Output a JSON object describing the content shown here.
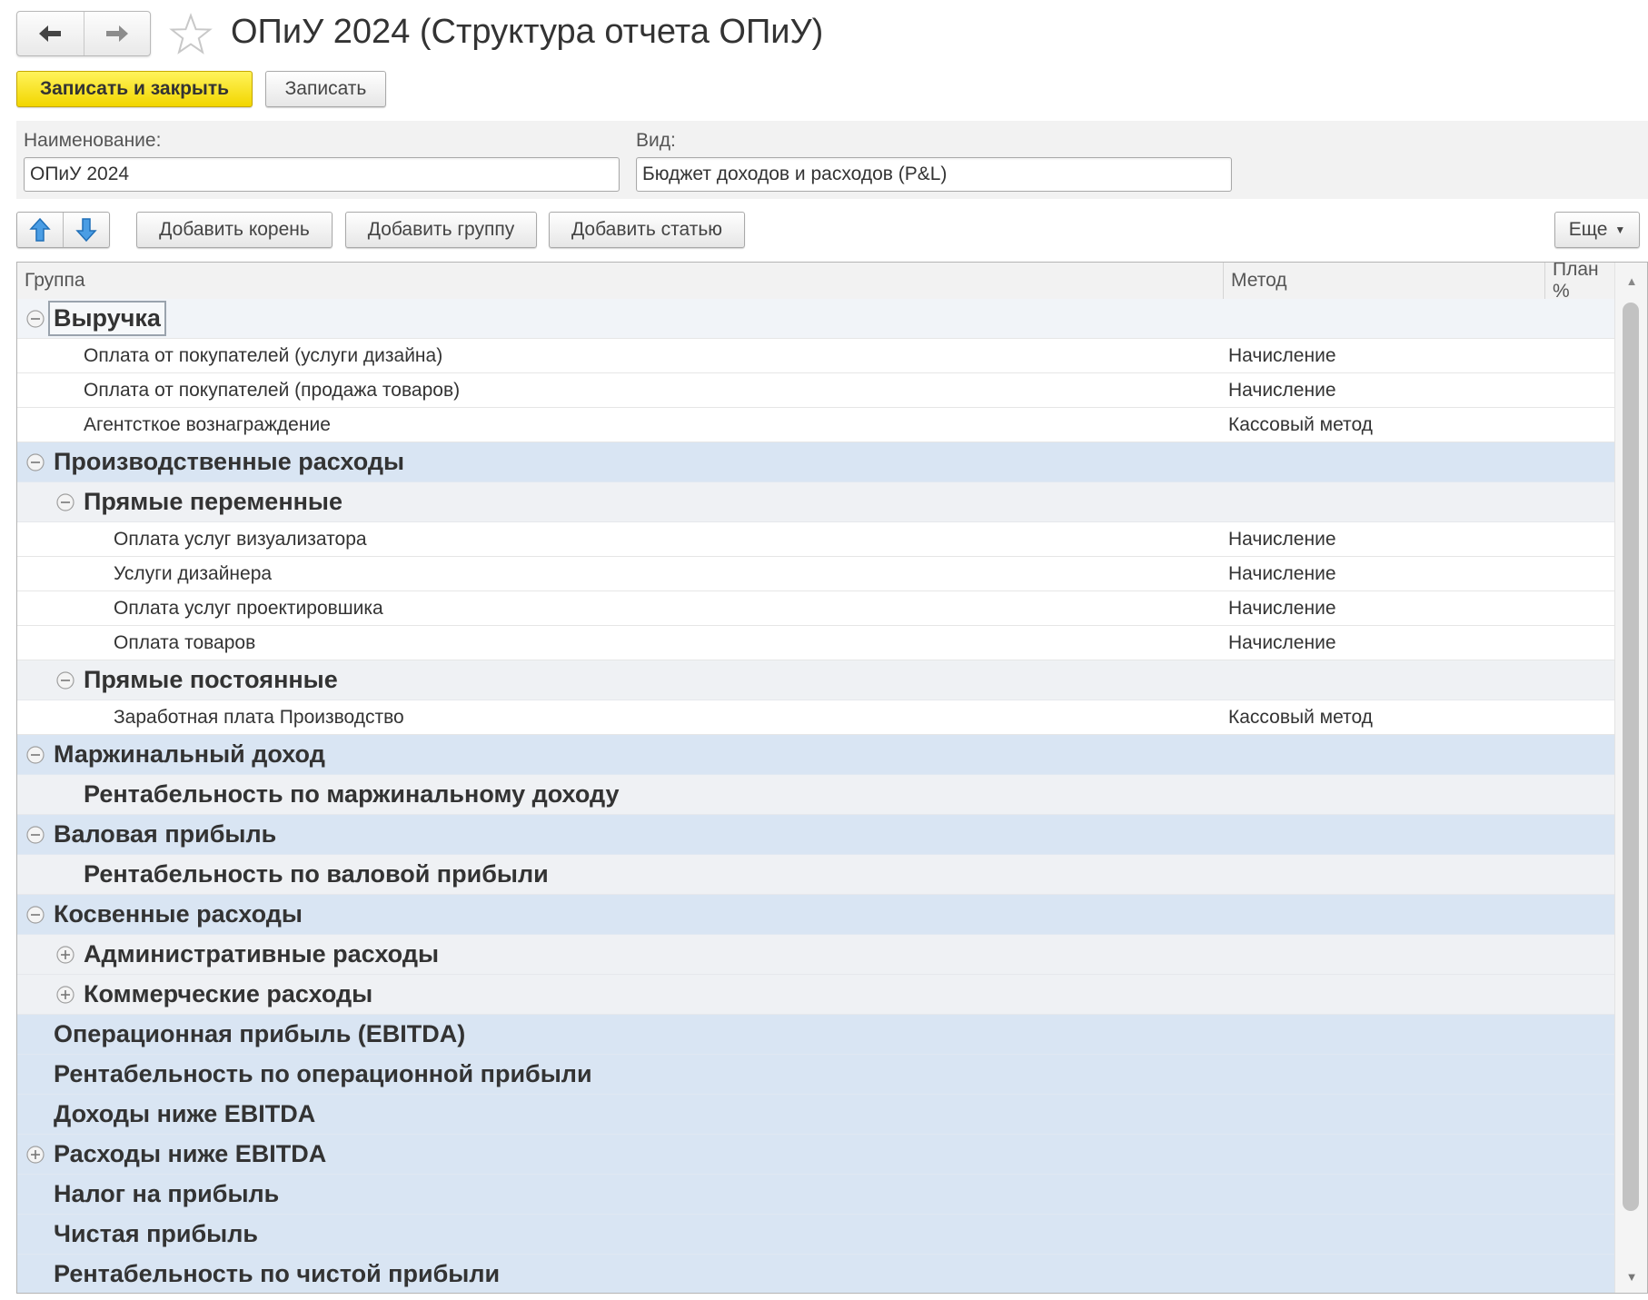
{
  "window": {
    "title": "ОПиУ 2024 (Структура отчета ОПиУ)",
    "back_icon": "arrow-left-icon",
    "forward_icon": "arrow-right-icon",
    "favorite_icon": "star-icon"
  },
  "command_bar": {
    "save_close_label": "Записать и закрыть",
    "save_label": "Записать"
  },
  "fields": {
    "name_label": "Наименование:",
    "name_value": "ОПиУ 2024",
    "kind_label": "Вид:",
    "kind_value": "Бюджет доходов и расходов (P&L)"
  },
  "toolbar": {
    "move_up_icon": "arrow-up-icon",
    "move_down_icon": "arrow-down-icon",
    "add_root_label": "Добавить корень",
    "add_group_label": "Добавить группу",
    "add_item_label": "Добавить статью",
    "more_label": "Еще"
  },
  "table": {
    "columns": [
      "Группа",
      "Метод",
      "План %"
    ],
    "rows": [
      {
        "name": "Выручка",
        "method": ""
      },
      {
        "name": "Оплата от покупателей (услуги дизайна)",
        "method": "Начисление"
      },
      {
        "name": "Оплата от покупателей (продажа товаров)",
        "method": "Начисление"
      },
      {
        "name": "Агентсткое вознаграждение",
        "method": "Кассовый метод"
      },
      {
        "name": "Производственные расходы",
        "method": ""
      },
      {
        "name": "Прямые переменные",
        "method": ""
      },
      {
        "name": "Оплата услуг визуализатора",
        "method": "Начисление"
      },
      {
        "name": "Услуги дизайнера",
        "method": "Начисление"
      },
      {
        "name": "Оплата услуг проектировшика",
        "method": "Начисление"
      },
      {
        "name": "Оплата товаров",
        "method": "Начисление"
      },
      {
        "name": "Прямые постоянные",
        "method": ""
      },
      {
        "name": "Заработная плата Производство",
        "method": "Кассовый метод"
      },
      {
        "name": "Маржинальный доход",
        "method": ""
      },
      {
        "name": "Рентабельность по маржинальному доходу",
        "method": ""
      },
      {
        "name": "Валовая прибыль",
        "method": ""
      },
      {
        "name": "Рентабельность по валовой прибыли",
        "method": ""
      },
      {
        "name": "Косвенные расходы",
        "method": ""
      },
      {
        "name": "Административные расходы",
        "method": ""
      },
      {
        "name": "Коммерческие расходы",
        "method": ""
      },
      {
        "name": "Операционная прибыль (EBITDA)",
        "method": ""
      },
      {
        "name": "Рентабельность по операционной прибыли",
        "method": ""
      },
      {
        "name": "Доходы ниже EBITDA",
        "method": ""
      },
      {
        "name": "Расходы ниже EBITDA",
        "method": ""
      },
      {
        "name": "Налог на прибыль",
        "method": ""
      },
      {
        "name": "Чистая прибыль",
        "method": ""
      },
      {
        "name": "Рентабельность по чистой прибыли",
        "method": ""
      }
    ]
  }
}
